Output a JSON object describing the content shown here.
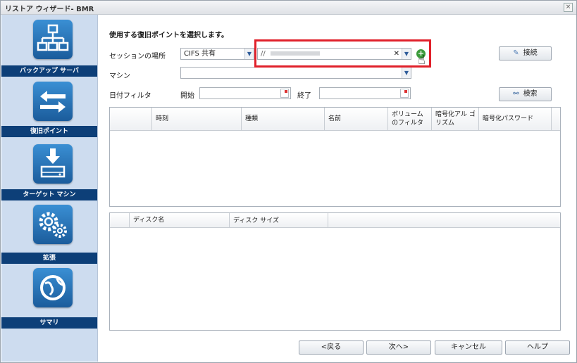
{
  "window": {
    "title": "リストア ウィザード- BMR",
    "close": "×"
  },
  "sidebar": {
    "steps": [
      {
        "label": "バックアップ サーバ",
        "icon": "network-tree-icon"
      },
      {
        "label": "復旧ポイント",
        "icon": "transfer-arrows-icon"
      },
      {
        "label": "ターゲット マシン",
        "icon": "download-drive-icon"
      },
      {
        "label": "拡張",
        "icon": "gears-icon"
      },
      {
        "label": "サマリ",
        "icon": "globe-icon"
      }
    ]
  },
  "main": {
    "heading": "使用する復旧ポイントを選択します。",
    "session_label": "セッションの場所",
    "session_type": "CIFS 共有",
    "session_path": "//",
    "machine_label": "マシン",
    "machine_value": "",
    "date_filter_label": "日付フィルタ",
    "start_label": "開始",
    "end_label": "終了",
    "connect_button": "接続",
    "search_button": "検索"
  },
  "recovery_table": {
    "columns": [
      "時刻",
      "種類",
      "名前",
      "ボリューム のフィルタ",
      "暗号化アル ゴリズム",
      "暗号化パスワード"
    ]
  },
  "disk_table": {
    "columns": [
      "ディスク名",
      "ディスク サイズ"
    ]
  },
  "footer": {
    "back": "<戻る",
    "next": "次へ>",
    "cancel": "キャンセル",
    "help": "ヘルプ"
  }
}
